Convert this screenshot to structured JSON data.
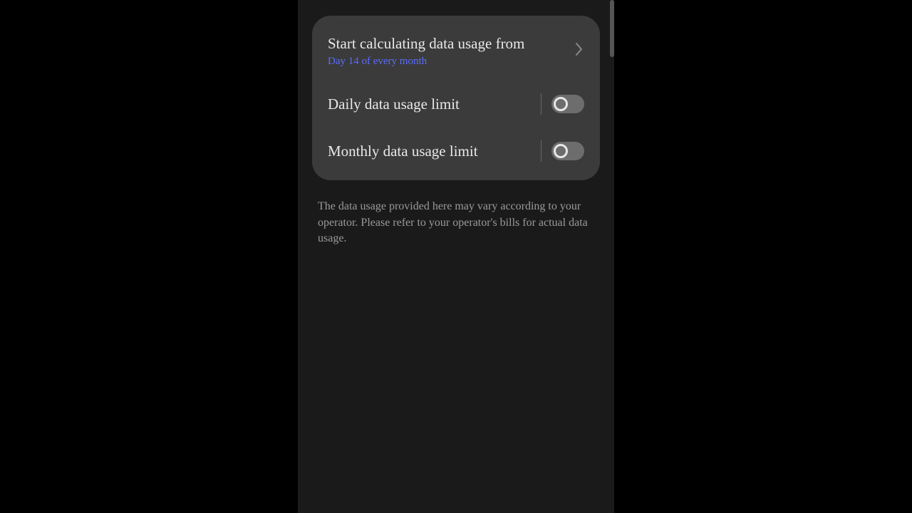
{
  "card": {
    "start_row": {
      "title": "Start calculating data usage from",
      "subtitle": "Day 14 of every month"
    },
    "daily_limit": {
      "label": "Daily data usage limit",
      "enabled": false
    },
    "monthly_limit": {
      "label": "Monthly data usage limit",
      "enabled": false
    }
  },
  "disclaimer": "The data usage provided here may vary according to your operator. Please refer to your operator's bills for actual data usage."
}
